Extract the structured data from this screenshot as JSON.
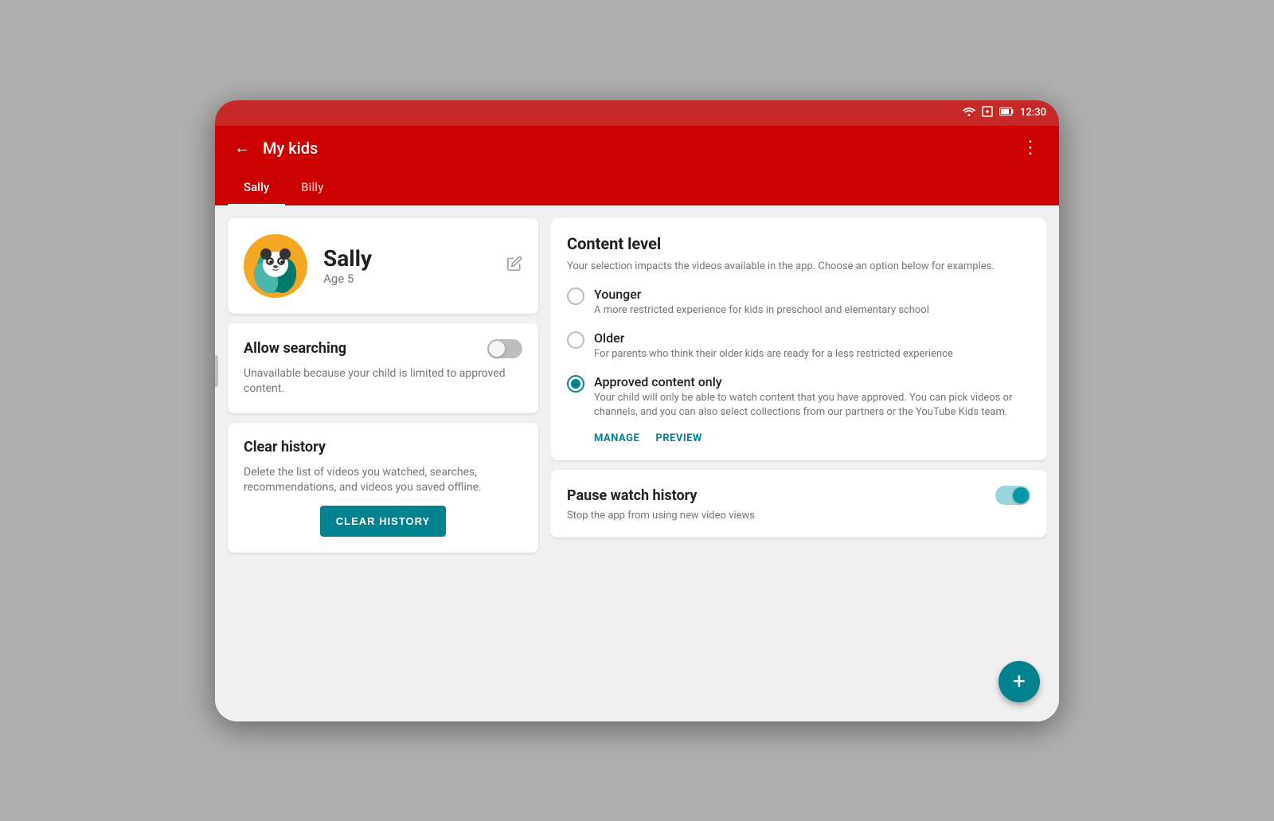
{
  "statusBar": {
    "time": "12:30",
    "icons": [
      "wifi",
      "battery-saver",
      "battery"
    ]
  },
  "toolbar": {
    "backLabel": "←",
    "title": "My kids",
    "moreLabel": "⋮"
  },
  "tabs": [
    {
      "label": "Sally",
      "active": true
    },
    {
      "label": "Billy",
      "active": false
    }
  ],
  "profile": {
    "name": "Sally",
    "age": "Age 5",
    "editIcon": "✎"
  },
  "allowSearching": {
    "title": "Allow searching",
    "description": "Unavailable because your child is limited to approved content.",
    "enabled": false
  },
  "clearHistory": {
    "title": "Clear history",
    "description": "Delete the list of videos you watched, searches, recommendations, and videos you saved offline.",
    "buttonLabel": "CLEAR HISTORY"
  },
  "contentLevel": {
    "title": "Content level",
    "description": "Your selection impacts the videos available in the app. Choose an option below for examples.",
    "options": [
      {
        "label": "Younger",
        "description": "A more restricted experience for kids in preschool and elementary school",
        "selected": false
      },
      {
        "label": "Older",
        "description": "For parents who think their older kids are ready for a less restricted experience",
        "selected": false
      },
      {
        "label": "Approved content only",
        "description": "Your child will only be able to watch content that you have approved. You can pick videos or channels, and you can also select collections from our partners or the YouTube Kids team.",
        "selected": true
      }
    ],
    "manageLabel": "MANAGE",
    "previewLabel": "PREVIEW"
  },
  "pauseWatchHistory": {
    "title": "Pause watch history",
    "description": "Stop the app from using new video views",
    "enabled": true
  },
  "fab": {
    "label": "+"
  }
}
